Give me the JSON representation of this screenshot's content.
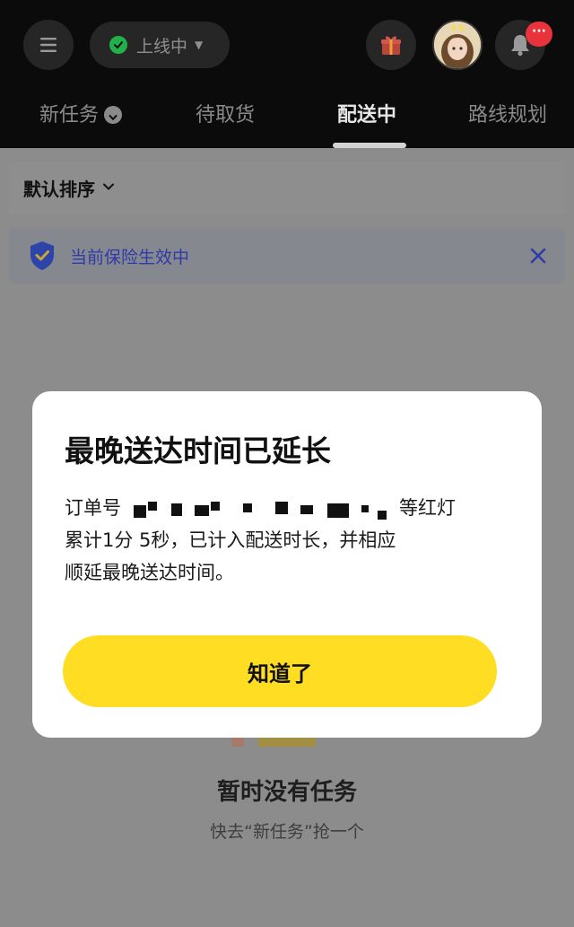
{
  "header": {
    "status": {
      "label": "上线中",
      "color": "#22b04a"
    },
    "notification_badge": "···",
    "tabs": [
      {
        "label": "新任务",
        "active": false
      },
      {
        "label": "待取货",
        "active": false
      },
      {
        "label": "配送中",
        "active": true
      },
      {
        "label": "路线规划",
        "active": false
      }
    ]
  },
  "content": {
    "sort_label": "默认排序",
    "insurance_text": "当前保险生效中",
    "empty_title": "暂时没有任务",
    "empty_subtitle": "快去“新任务”抢一个"
  },
  "dialog": {
    "title": "最晚送达时间已延长",
    "body_prefix": "订单号",
    "body_line1_suffix": "等红灯",
    "body_line2": "累计1分 5秒，已计入配送时长，并相应",
    "body_line3": "顺延最晚送达时间。",
    "confirm_label": "知道了",
    "confirm_color": "#ffdd22"
  },
  "icons": [
    "menu-icon",
    "check-icon",
    "chevron-down-icon",
    "gift-icon",
    "bell-icon",
    "shield-check-icon",
    "close-icon"
  ]
}
